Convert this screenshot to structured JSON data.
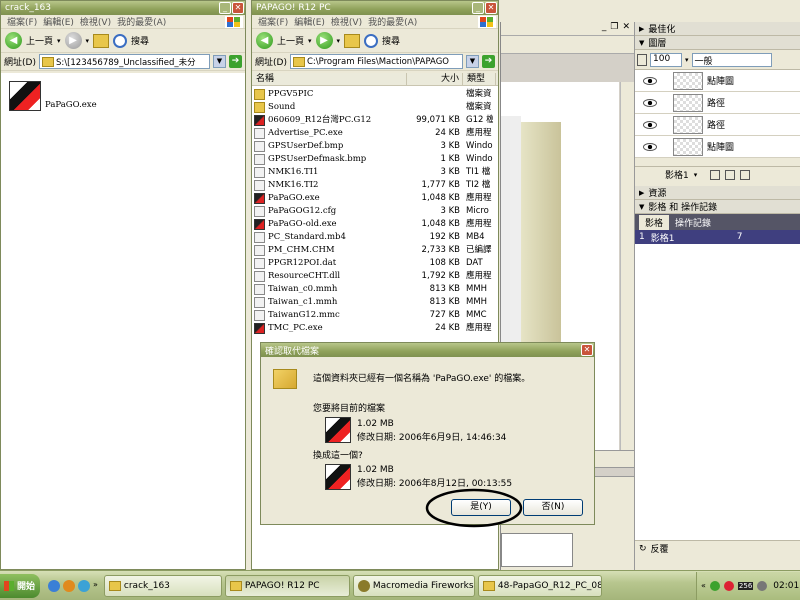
{
  "window_left": {
    "title": "crack_163",
    "menu": [
      "檔案(F)",
      "編輯(E)",
      "檢視(V)",
      "我的最愛(A)"
    ],
    "back_label": "上一頁",
    "search_label": "搜尋",
    "address_label": "網址(D)",
    "address_value": "S:\\[123456789_Unclassified_未分",
    "file_name": "PaPaGO.exe"
  },
  "window_mid": {
    "title": "PAPAGO! R12 PC",
    "menu": [
      "檔案(F)",
      "編輯(E)",
      "檢視(V)",
      "我的最愛(A)"
    ],
    "back_label": "上一頁",
    "search_label": "搜尋",
    "address_label": "網址(D)",
    "address_value": "C:\\Program Files\\Maction\\PAPAGO",
    "columns": [
      "名稱",
      "大小",
      "類型"
    ],
    "files": [
      {
        "name": "PPGV5PIC",
        "size": "",
        "type": "檔案資",
        "icon": "folder"
      },
      {
        "name": "Sound",
        "size": "",
        "type": "檔案資",
        "icon": "folder"
      },
      {
        "name": "060609_R12台灣PC.G12",
        "size": "99,071 KB",
        "type": "G12 檔",
        "icon": "exe"
      },
      {
        "name": "Advertise_PC.exe",
        "size": "24 KB",
        "type": "應用程",
        "icon": "doc"
      },
      {
        "name": "GPSUserDef.bmp",
        "size": "3 KB",
        "type": "Windo",
        "icon": "doc"
      },
      {
        "name": "GPSUserDefmask.bmp",
        "size": "1 KB",
        "type": "Windo",
        "icon": "doc"
      },
      {
        "name": "NMK16.TI1",
        "size": "3 KB",
        "type": "TI1 檔",
        "icon": "doc"
      },
      {
        "name": "NMK16.TI2",
        "size": "1,777 KB",
        "type": "TI2 檔",
        "icon": "doc"
      },
      {
        "name": "PaPaGO.exe",
        "size": "1,048 KB",
        "type": "應用程",
        "icon": "exe"
      },
      {
        "name": "PaPaGOG12.cfg",
        "size": "3 KB",
        "type": "Micro",
        "icon": "doc"
      },
      {
        "name": "PaPaGO-old.exe",
        "size": "1,048 KB",
        "type": "應用程",
        "icon": "exe"
      },
      {
        "name": "PC_Standard.mb4",
        "size": "192 KB",
        "type": "MB4 ",
        "icon": "doc"
      },
      {
        "name": "PM_CHM.CHM",
        "size": "2,733 KB",
        "type": "已編譯",
        "icon": "doc"
      },
      {
        "name": "PPGR12POI.dat",
        "size": "108 KB",
        "type": "DAT ",
        "icon": "doc"
      },
      {
        "name": "ResourceCHT.dll",
        "size": "1,792 KB",
        "type": "應用程",
        "icon": "doc"
      },
      {
        "name": "Taiwan_c0.mmh",
        "size": "813 KB",
        "type": "MMH ",
        "icon": "doc"
      },
      {
        "name": "Taiwan_c1.mmh",
        "size": "813 KB",
        "type": "MMH ",
        "icon": "doc"
      },
      {
        "name": "TaiwanG12.mmc",
        "size": "727 KB",
        "type": "MMC ",
        "icon": "doc"
      },
      {
        "name": "TMC_PC.exe",
        "size": "24 KB",
        "type": "應用程",
        "icon": "exe"
      }
    ]
  },
  "dialog": {
    "title": "確認取代檔案",
    "message": "這個資料夾已經有一個名稱為 'PaPaGO.exe' 的檔案。",
    "question1": "您要將目前的檔案",
    "cur_size": "1.02 MB",
    "cur_date": "修改日期: 2006年6月9日, 14:46:34",
    "question2": "換成這一個?",
    "new_size": "1.02 MB",
    "new_date": "修改日期: 2006年8月12日, 00:13:55",
    "yes_label": "是(Y)",
    "no_label": "否(N)"
  },
  "fireworks": {
    "optimize_label": "最佳化",
    "layers_label": "圖層",
    "opacity_value": "100",
    "blend_value": "一般",
    "layer_items": [
      "點陣圖",
      "路徑",
      "路徑",
      "點陣圖"
    ],
    "frame_label": "影格1",
    "assets_label": "資源",
    "frames_history_label": "影格 和 操作記錄",
    "tab_frames": "影格",
    "tab_history": "操作記錄",
    "frame_row_num": "1",
    "frame_row_name": "影格1",
    "frame_row_delay": "7",
    "bottom_label": "反覆"
  },
  "taskbar": {
    "start_label": "開始",
    "tasks": [
      "crack_163",
      "PAPAGO! R12 PC",
      "Macromedia Fireworks M...",
      "48-PapaGO_R12_PC_08..."
    ],
    "tray_number": "256",
    "clock": "02:01"
  },
  "colors": {
    "title_olive": "#8FA15A",
    "close_red": "#C9543A",
    "exe_red": "#D22"
  }
}
